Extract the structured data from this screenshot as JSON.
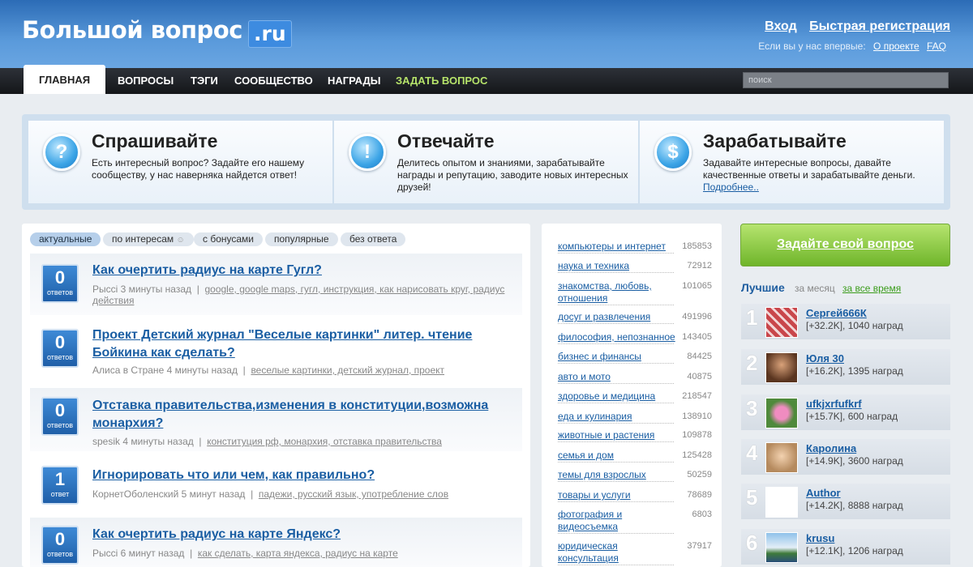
{
  "header": {
    "logo": "Большой вопрос",
    "logo_suffix": ".ru",
    "login": "Вход",
    "register": "Быстрая регистрация",
    "first_time": "Если вы у нас впервые:",
    "about": "О проекте",
    "faq": "FAQ"
  },
  "nav": {
    "items": [
      "ГЛАВНАЯ",
      "ВОПРОСЫ",
      "ТЭГИ",
      "СООБЩЕСТВО",
      "НАГРАДЫ",
      "ЗАДАТЬ ВОПРОС"
    ],
    "search_placeholder": "поиск"
  },
  "promo": [
    {
      "icon": "question-icon",
      "glyph": "?",
      "title": "Спрашивайте",
      "text": "Есть интересный вопрос? Задайте его нашему сообществу, у нас наверняка найдется ответ!"
    },
    {
      "icon": "exclamation-icon",
      "glyph": "!",
      "title": "Отвечайте",
      "text": "Делитесь опытом и знаниями, зарабатывайте награды и репутацию, заводите новых интересных друзей!"
    },
    {
      "icon": "dollar-icon",
      "glyph": "$",
      "title": "Зарабатывайте",
      "text": "Задавайте интересные вопросы, давайте качественные ответы и зарабатывайте деньги.",
      "link": "Подробнее.."
    }
  ],
  "filters": [
    "актуальные",
    "по интересам",
    "с бонусами",
    "популярные",
    "без ответа"
  ],
  "questions": [
    {
      "count": "0",
      "count_label": "ответов",
      "title": "Как очертить радиус на карте Гугл?",
      "author": "Рыссi",
      "time": "3 минуты назад",
      "tags": "google, google maps, гугл, инструкция, как нарисовать круг, радиус действия"
    },
    {
      "count": "0",
      "count_label": "ответов",
      "title": "Проект Детский журнал \"Веселые картинки\" литер. чтение Бойкина как сделать?",
      "author": "Алиса в Стране",
      "time": "4 минуты назад",
      "tags": "веселые картинки, детский журнал, проект"
    },
    {
      "count": "0",
      "count_label": "ответов",
      "title": "Отставка правительства,изменения в конституции,возможна монархия?",
      "author": "spesik",
      "time": "4 минуты назад",
      "tags": "конституция рф, монархия, отставка правительства"
    },
    {
      "count": "1",
      "count_label": "ответ",
      "title": "Игнорировать что или чем, как правильно?",
      "author": "КорнетОболенский",
      "time": "5 минут назад",
      "tags": "падежи, русский язык, употребление слов"
    },
    {
      "count": "0",
      "count_label": "ответов",
      "title": "Как очертить радиус на карте Яндекс?",
      "author": "Рыссi",
      "time": "6 минут назад",
      "tags": "как сделать, карта яндекса, радиус на карте"
    }
  ],
  "categories": [
    {
      "name": "компьютеры и интернет",
      "count": "185853"
    },
    {
      "name": "наука и техника",
      "count": "72912"
    },
    {
      "name": "знакомства, любовь, отношения",
      "count": "101065"
    },
    {
      "name": "досуг и развлечения",
      "count": "491996"
    },
    {
      "name": "философия, непознанное",
      "count": "143405"
    },
    {
      "name": "бизнес и финансы",
      "count": "84425"
    },
    {
      "name": "авто и мото",
      "count": "40875"
    },
    {
      "name": "здоровье и медицина",
      "count": "218547"
    },
    {
      "name": "еда и кулинария",
      "count": "138910"
    },
    {
      "name": "животные и растения",
      "count": "109878"
    },
    {
      "name": "семья и дом",
      "count": "125428"
    },
    {
      "name": "темы для взрослых",
      "count": "50259"
    },
    {
      "name": "товары и услуги",
      "count": "78689"
    },
    {
      "name": "фотография и видеосъемка",
      "count": "6803"
    },
    {
      "name": "юридическая консультация",
      "count": "37917"
    }
  ],
  "sidebar": {
    "ask_button": "Задайте свой вопрос",
    "best_title": "Лучшие",
    "best_month": "за месяц",
    "best_all": "за все время",
    "users": [
      {
        "rank": "1",
        "name": "Сергей666К",
        "stats": "[+32.2K], 1040 наград",
        "avatar_color": "#c9464b"
      },
      {
        "rank": "2",
        "name": "Юля 30",
        "stats": "[+16.2K], 1395 наград",
        "avatar_color": "#8a5a3a"
      },
      {
        "rank": "3",
        "name": "ufkjxrfufkrf",
        "stats": "[+15.7K], 600 наград",
        "avatar_color": "#d4609a"
      },
      {
        "rank": "4",
        "name": "Каролина",
        "stats": "[+14.9K], 3600 наград",
        "avatar_color": "#c79a6b"
      },
      {
        "rank": "5",
        "name": "Author",
        "stats": "[+14.2K], 8888 наград",
        "avatar_color": "#ffffff"
      },
      {
        "rank": "6",
        "name": "krusu",
        "stats": "[+12.1K], 1206 наград",
        "avatar_color": "#6a9cc9"
      }
    ]
  }
}
